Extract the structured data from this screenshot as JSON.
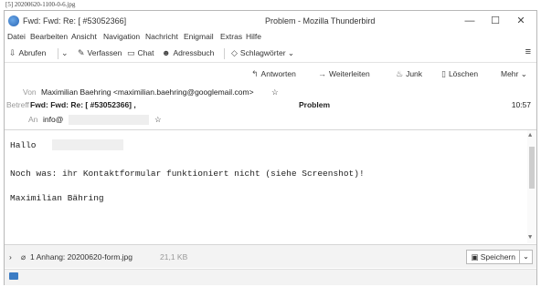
{
  "caption": "[5] 20200620-1100-0-6.jpg",
  "window": {
    "title_left": "Fwd: Fwd: Re: [",
    "title_number": "#53052366]",
    "title_right": "Problem - Mozilla Thunderbird",
    "minimize": "—",
    "maximize": "☐",
    "close": "✕"
  },
  "menu": [
    "Datei",
    "Bearbeiten",
    "Ansicht",
    "Navigation",
    "Nachricht",
    "Enigmail",
    "Extras",
    "Hilfe"
  ],
  "toolbar": {
    "get": "Abrufen",
    "write": "Verfassen",
    "chat": "Chat",
    "addressbook": "Adressbuch",
    "tags": "Schlagwörter",
    "menu": "≡"
  },
  "actions": {
    "reply": "Antworten",
    "forward": "Weiterleiten",
    "junk": "Junk",
    "delete": "Löschen",
    "more": "Mehr"
  },
  "header": {
    "from_label": "Von",
    "from_value": "Maximilian Baehring <maximilian.baehring@googlemail.com>",
    "subject_label": "Betreff",
    "subject_value": "Fwd: Fwd: Re: [  #53052366] ,",
    "subject_end": "Problem",
    "time": "10:57",
    "to_label": "An",
    "to_value": "info@"
  },
  "body": {
    "greeting": "Hallo",
    "line1": "Noch was: ihr Kontaktformular funktioniert nicht (siehe Screenshot)!",
    "signature": "Maximilian Bähring"
  },
  "attachment": {
    "summary": "1 Anhang: 20200620-form.jpg",
    "size": "21,1 KB",
    "save": "Speichern"
  },
  "colors": {
    "accent": "#3b7cc4",
    "label_gray": "#999999",
    "border": "#d6d6d6"
  }
}
